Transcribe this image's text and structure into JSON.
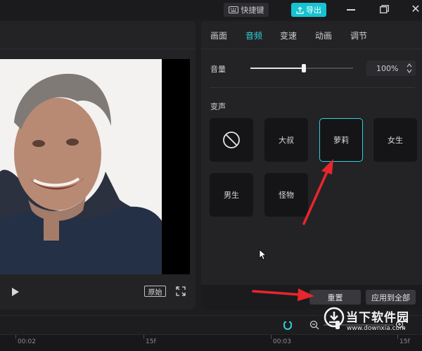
{
  "titlebar": {
    "shortcut_label": "快捷键",
    "export_label": "导出",
    "accent_color": "#17c3d0"
  },
  "player": {
    "ratio_label": "原始",
    "play_icon": "play-icon",
    "fullscreen_icon": "fullscreen-icon"
  },
  "panel": {
    "tabs": [
      {
        "label": "画面",
        "active": false
      },
      {
        "label": "音频",
        "active": true
      },
      {
        "label": "变速",
        "active": false
      },
      {
        "label": "动画",
        "active": false
      },
      {
        "label": "调节",
        "active": false
      }
    ],
    "volume_label": "音量",
    "volume_value": "100%",
    "volume_slider_fraction": 0.52,
    "voice_change_label": "变声",
    "voices": [
      {
        "label": "",
        "icon": "no-voice-icon",
        "selected": false
      },
      {
        "label": "大叔",
        "selected": false
      },
      {
        "label": "萝莉",
        "selected": true
      },
      {
        "label": "女生",
        "selected": false
      },
      {
        "label": "男生",
        "selected": false
      },
      {
        "label": "怪物",
        "selected": false
      }
    ],
    "reset_label": "重置",
    "apply_all_label": "应用到全部",
    "selected_color": "#2ed1da"
  },
  "timeline": {
    "ticks": [
      "00:02",
      "15f",
      "00:03",
      "15f"
    ]
  },
  "watermark": {
    "name": "当下软件园",
    "url": "www.downxia.com"
  },
  "annotation_color": "#e8262c"
}
